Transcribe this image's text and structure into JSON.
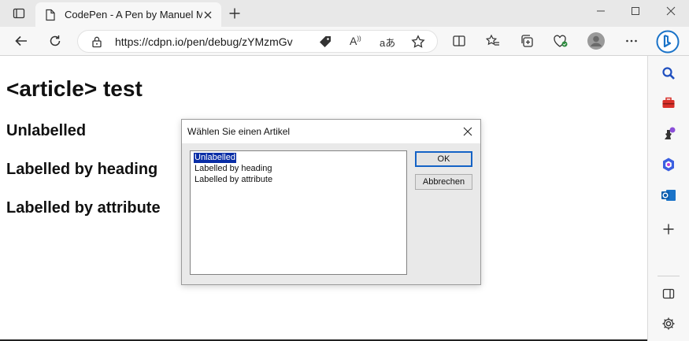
{
  "browser": {
    "tab_title": "CodePen - A Pen by Manuel Matuzović",
    "url": "https://cdpn.io/pen/debug/zYMzmGv"
  },
  "page": {
    "heading": "<article> test",
    "sections": [
      "Unlabelled",
      "Labelled by heading",
      "Labelled by attribute"
    ]
  },
  "dialog": {
    "title": "Wählen Sie einen Artikel",
    "options": [
      "Unlabelled",
      "Labelled by heading",
      "Labelled by attribute"
    ],
    "selected_option": "Unlabelled",
    "ok_label": "OK",
    "cancel_label": "Abbrechen"
  },
  "colors": {
    "selection": "#0a2ea6",
    "accent": "#1563c6"
  }
}
